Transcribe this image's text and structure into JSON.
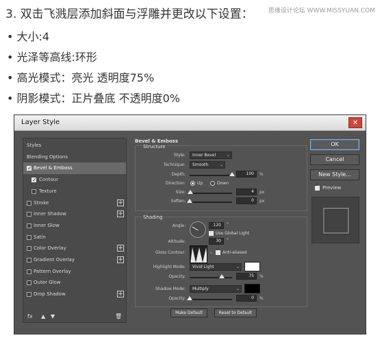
{
  "header": {
    "headline": "3. 双击飞溅层添加斜面与浮雕并更改以下设置：",
    "watermark": "思缘设计论坛 WWW.MISSYUAN.COM",
    "bullets": [
      "• 大小:4",
      "• 光泽等高线:环形",
      "• 高光模式：亮光    透明度75%",
      "• 阴影模式：正片叠底 不透明度0%"
    ]
  },
  "window": {
    "title": "Layer Style",
    "close_label": "✕"
  },
  "left_list": {
    "items": [
      {
        "label": "Styles",
        "checkbox": false,
        "checked": false,
        "plus": false,
        "selected": false,
        "indent": false
      },
      {
        "label": "Blending Options",
        "checkbox": false,
        "checked": false,
        "plus": false,
        "selected": false,
        "indent": false
      },
      {
        "label": "Bevel & Emboss",
        "checkbox": true,
        "checked": true,
        "plus": false,
        "selected": true,
        "indent": false
      },
      {
        "label": "Contour",
        "checkbox": true,
        "checked": true,
        "plus": false,
        "selected": false,
        "indent": true
      },
      {
        "label": "Texture",
        "checkbox": true,
        "checked": false,
        "plus": false,
        "selected": false,
        "indent": true
      },
      {
        "label": "Stroke",
        "checkbox": true,
        "checked": false,
        "plus": true,
        "selected": false,
        "indent": false
      },
      {
        "label": "Inner Shadow",
        "checkbox": true,
        "checked": false,
        "plus": true,
        "selected": false,
        "indent": false
      },
      {
        "label": "Inner Glow",
        "checkbox": true,
        "checked": false,
        "plus": false,
        "selected": false,
        "indent": false
      },
      {
        "label": "Satin",
        "checkbox": true,
        "checked": false,
        "plus": false,
        "selected": false,
        "indent": false
      },
      {
        "label": "Color Overlay",
        "checkbox": true,
        "checked": false,
        "plus": true,
        "selected": false,
        "indent": false
      },
      {
        "label": "Gradient Overlay",
        "checkbox": true,
        "checked": false,
        "plus": true,
        "selected": false,
        "indent": false
      },
      {
        "label": "Pattern Overlay",
        "checkbox": true,
        "checked": false,
        "plus": false,
        "selected": false,
        "indent": false
      },
      {
        "label": "Outer Glow",
        "checkbox": true,
        "checked": false,
        "plus": false,
        "selected": false,
        "indent": false
      },
      {
        "label": "Drop Shadow",
        "checkbox": true,
        "checked": false,
        "plus": true,
        "selected": false,
        "indent": false
      }
    ],
    "toolbar": {
      "fx": "fx",
      "up": "▲",
      "down": "▼",
      "trash": "🗑"
    }
  },
  "bevel": {
    "section_title": "Bevel & Emboss",
    "structure_title": "Structure",
    "style_label": "Style:",
    "style_value": "Inner Bevel",
    "technique_label": "Technique:",
    "technique_value": "Smooth",
    "depth_label": "Depth:",
    "depth_value": "100",
    "depth_level": 1.0,
    "depth_unit": "%",
    "direction_label": "Direction:",
    "direction_up": "Up",
    "direction_down": "Down",
    "size_label": "Size:",
    "size_value": "4",
    "size_level": 0.02,
    "size_unit": "px",
    "soften_label": "Soften:",
    "soften_value": "0",
    "soften_level": 0,
    "soften_unit": "px"
  },
  "shading": {
    "title": "Shading",
    "angle_label": "Angle:",
    "angle_value": "120",
    "angle_unit": "°",
    "global_light_label": "Use Global Light",
    "altitude_label": "Altitude:",
    "altitude_value": "30",
    "altitude_unit": "°",
    "gloss_label": "Gloss Contour:",
    "anti_aliased_label": "Anti-aliased",
    "highlight_mode_label": "Highlight Mode:",
    "highlight_mode_value": "Vivid Light",
    "highlight_color": "#ffffff",
    "hl_opacity_label": "Opacity:",
    "hl_opacity_value": "75",
    "hl_opacity_level": 0.75,
    "hl_opacity_unit": "%",
    "shadow_mode_label": "Shadow Mode:",
    "shadow_mode_value": "Multiply",
    "shadow_color": "#000000",
    "sh_opacity_label": "Opacity:",
    "sh_opacity_value": "0",
    "sh_opacity_level": 0,
    "sh_opacity_unit": "%",
    "make_default": "Make Default",
    "reset_default": "Reset to Default"
  },
  "right": {
    "ok": "OK",
    "cancel": "Cancel",
    "new_style": "New Style...",
    "preview_label": "Preview"
  }
}
